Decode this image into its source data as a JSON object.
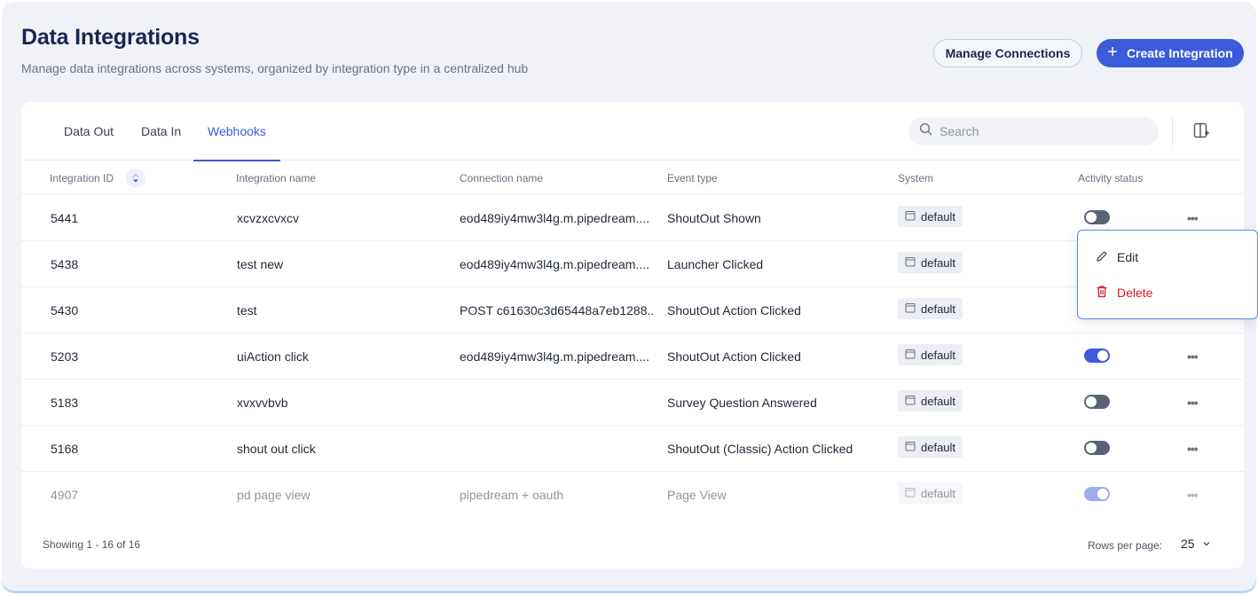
{
  "header": {
    "title": "Data Integrations",
    "subtitle": "Manage data integrations across systems, organized by integration type in a centralized hub",
    "manage_label": "Manage Connections",
    "create_label": "Create Integration"
  },
  "tabs": [
    {
      "label": "Data Out",
      "active": false
    },
    {
      "label": "Data In",
      "active": false
    },
    {
      "label": "Webhooks",
      "active": true
    }
  ],
  "search": {
    "placeholder": "Search",
    "value": ""
  },
  "columns": {
    "id": "Integration ID",
    "name": "Integration name",
    "connection": "Connection name",
    "event": "Event type",
    "system": "System",
    "status": "Activity status"
  },
  "rows": [
    {
      "id": "5441",
      "name": "xcvzxcvxcv",
      "connection": "eod489iy4mw3l4g.m.pipedream....",
      "event": "ShoutOut Shown",
      "system": "default",
      "active": false,
      "menu_open": true
    },
    {
      "id": "5438",
      "name": "test new",
      "connection": "eod489iy4mw3l4g.m.pipedream....",
      "event": "Launcher Clicked",
      "system": "default",
      "active": null
    },
    {
      "id": "5430",
      "name": "test",
      "connection": "POST c61630c3d65448a7eb1288...",
      "event": "ShoutOut Action Clicked",
      "system": "default",
      "active": null
    },
    {
      "id": "5203",
      "name": "uiAction click",
      "connection": "eod489iy4mw3l4g.m.pipedream....",
      "event": "ShoutOut Action Clicked",
      "system": "default",
      "active": true
    },
    {
      "id": "5183",
      "name": "xvxvvbvb",
      "connection": "",
      "event": "Survey Question Answered",
      "system": "default",
      "active": false
    },
    {
      "id": "5168",
      "name": "shout out click",
      "connection": "",
      "event": "ShoutOut (Classic) Action Clicked",
      "system": "default",
      "active": false
    },
    {
      "id": "4907",
      "name": "pd page view",
      "connection": "pipedream + oauth",
      "event": "Page View",
      "system": "default",
      "active": true
    }
  ],
  "menu": {
    "edit_label": "Edit",
    "delete_label": "Delete"
  },
  "footer": {
    "showing": "Showing 1 - 16 of 16",
    "rows_per_page_label": "Rows per page:",
    "rows_per_page_value": "25"
  },
  "colors": {
    "accent": "#3b5bdb",
    "danger": "#d11a2a",
    "toggle_off": "#5a6278"
  }
}
